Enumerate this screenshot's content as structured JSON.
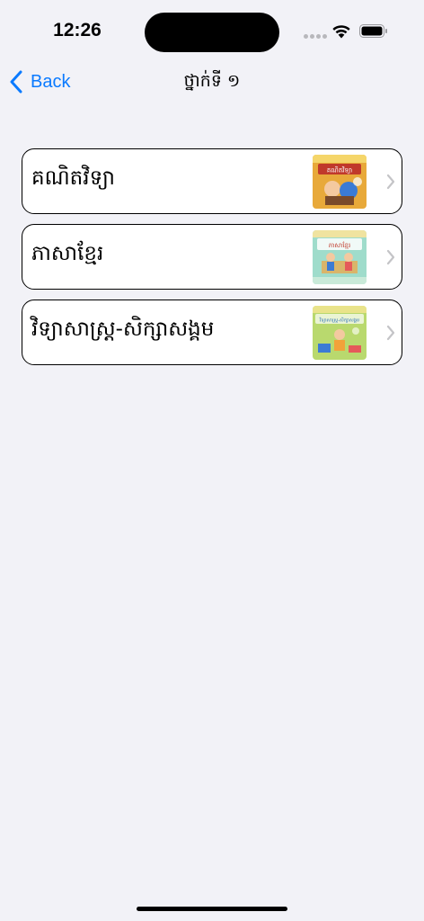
{
  "status_bar": {
    "time": "12:26",
    "icons": [
      "signal-dots-icon",
      "wifi-icon",
      "battery-icon"
    ]
  },
  "nav": {
    "back_label": "Back",
    "title": "ថ្នាក់ទី ១",
    "accent_color": "#0a7aff"
  },
  "subjects": [
    {
      "label": "គណិតវិទ្យា",
      "cover_title": "គណិតវិទ្យា",
      "cover_colors": [
        "#e8b640",
        "#c0392b"
      ]
    },
    {
      "label": "ភាសាខ្មែរ",
      "cover_title": "ភាសាខ្មែរ",
      "cover_colors": [
        "#8fd6c4",
        "#e6c94a"
      ]
    },
    {
      "label": "វិទ្យាសាស្ត្រ-សិក្សាសង្គម",
      "cover_title": "វិទ្យាសាស្ត្រ-សិក្សាសង្គម",
      "cover_colors": [
        "#b8d96a",
        "#f2a23a"
      ]
    }
  ]
}
